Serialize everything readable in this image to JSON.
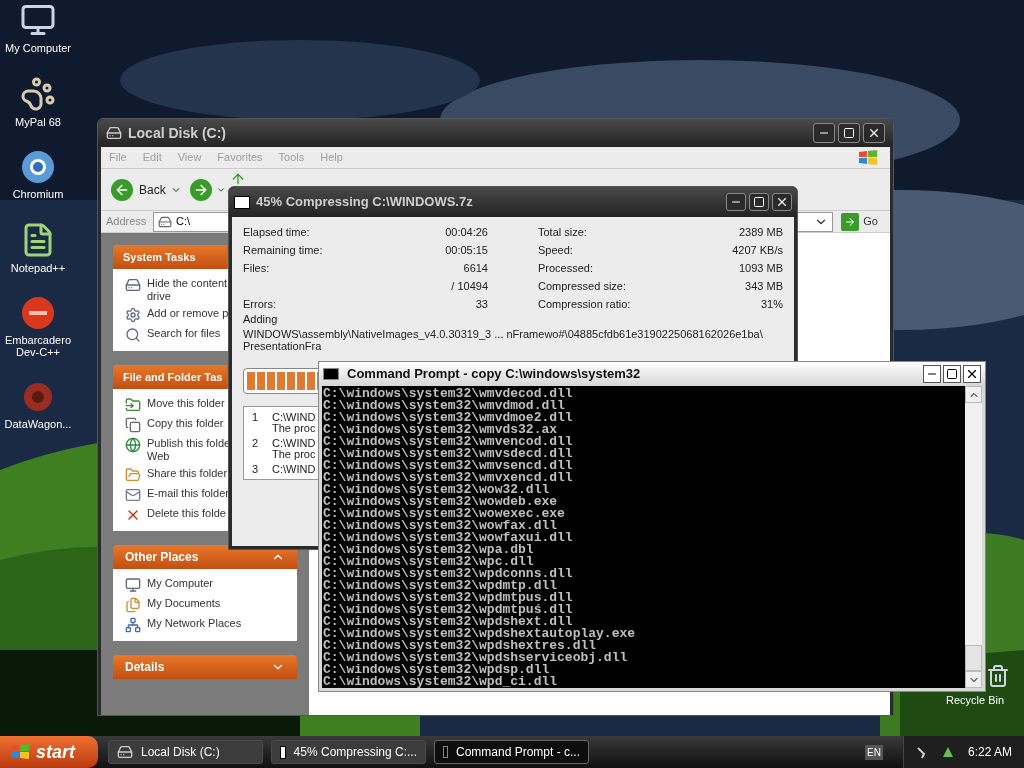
{
  "desktop_icons": [
    {
      "label": "My Computer",
      "kind": "computer"
    },
    {
      "label": "MyPal 68",
      "kind": "browser-paw"
    },
    {
      "label": "Chromium",
      "kind": "browser-round"
    },
    {
      "label": "Notepad++",
      "kind": "editor"
    },
    {
      "label": "Embarcadero Dev-C++",
      "kind": "ide"
    },
    {
      "label": "DataWagon...",
      "kind": "app"
    }
  ],
  "recycle_bin": {
    "label": "Recycle Bin"
  },
  "explorer": {
    "title": "Local Disk (C:)",
    "menu": [
      "File",
      "Edit",
      "View",
      "Favorites",
      "Tools",
      "Help"
    ],
    "back": "Back",
    "address_label": "Address",
    "address_value": "C:\\",
    "go": "Go",
    "panels": [
      {
        "title": "System Tasks",
        "kind": "plain",
        "expanded": true,
        "items": [
          {
            "kind": "drive",
            "lines": [
              "Hide the content",
              "drive"
            ]
          },
          {
            "kind": "gear",
            "lines": [
              "Add or remove p"
            ]
          },
          {
            "kind": "search",
            "lines": [
              "Search for files"
            ]
          }
        ]
      },
      {
        "title": "File and Folder Tas",
        "kind": "plain",
        "expanded": true,
        "items": [
          {
            "kind": "move",
            "lines": [
              "Move this folder"
            ]
          },
          {
            "kind": "copy",
            "lines": [
              "Copy this folder"
            ]
          },
          {
            "kind": "globe",
            "lines": [
              "Publish this folde",
              "Web"
            ]
          },
          {
            "kind": "share",
            "lines": [
              "Share this folder"
            ]
          },
          {
            "kind": "mail",
            "lines": [
              "E-mail this folder"
            ]
          },
          {
            "kind": "delete",
            "lines": [
              "Delete this folde"
            ]
          }
        ]
      },
      {
        "title": "Other Places",
        "kind": "toggle",
        "expanded": true,
        "items": [
          {
            "kind": "computer",
            "lines": [
              "My Computer"
            ]
          },
          {
            "kind": "docs",
            "lines": [
              "My Documents"
            ]
          },
          {
            "kind": "network",
            "lines": [
              "My Network Places"
            ]
          }
        ]
      },
      {
        "title": "Details",
        "kind": "toggle",
        "expanded": false
      }
    ]
  },
  "sevenzip": {
    "title": "45% Compressing C:\\WINDOWS.7z",
    "left_stats": [
      {
        "label": "Elapsed time:",
        "value": "00:04:26"
      },
      {
        "label": "Remaining time:",
        "value": "00:05:15"
      },
      {
        "label": "Files:",
        "value": "6614"
      },
      {
        "value": "/ 10494"
      },
      {
        "label": "Errors:",
        "value": "33"
      }
    ],
    "right_stats": [
      {
        "label": "Total size:",
        "value": "2389 MB"
      },
      {
        "label": "Speed:",
        "value": "4207 KB/s"
      },
      {
        "label": "Processed:",
        "value": "1093 MB"
      },
      {
        "label": "Compressed size:",
        "value": "343 MB"
      },
      {
        "label": "Compression ratio:",
        "value": "31%"
      }
    ],
    "action": "Adding",
    "path_lines": [
      "WINDOWS\\assembly\\NativeImages_v4.0.30319_3 ... nFramewo#\\04885cfdb61e3190225068162026e1ba\\",
      "PresentationFra"
    ],
    "progress": {
      "level": 0.45
    },
    "errors": [
      {
        "num": "1",
        "path": "C:\\WIND",
        "message": "The proc"
      },
      {
        "num": "2",
        "path": "C:\\WIND",
        "message": "The proc"
      },
      {
        "num": "3",
        "path": "C:\\WIND"
      }
    ]
  },
  "console": {
    "title": "Command Prompt - copy C:\\windows\\system32",
    "lines": [
      "C:\\windows\\system32\\wmvdecod.dll",
      "C:\\windows\\system32\\wmvdmod.dll",
      "C:\\windows\\system32\\wmvdmoe2.dll",
      "C:\\windows\\system32\\wmvds32.ax",
      "C:\\windows\\system32\\wmvencod.dll",
      "C:\\windows\\system32\\wmvsdecd.dll",
      "C:\\windows\\system32\\wmvsencd.dll",
      "C:\\windows\\system32\\wmvxencd.dll",
      "C:\\windows\\system32\\wow32.dll",
      "C:\\windows\\system32\\wowdeb.exe",
      "C:\\windows\\system32\\wowexec.exe",
      "C:\\windows\\system32\\wowfax.dll",
      "C:\\windows\\system32\\wowfaxui.dll",
      "C:\\windows\\system32\\wpa.dbl",
      "C:\\windows\\system32\\wpc.dll",
      "C:\\windows\\system32\\wpdconns.dll",
      "C:\\windows\\system32\\wpdmtp.dll",
      "C:\\windows\\system32\\wpdmtpus.dll",
      "C:\\windows\\system32\\wpdmtpuś.dll",
      "C:\\windows\\system32\\wpdshext.dll",
      "C:\\windows\\system32\\wpdshextautoplay.exe",
      "C:\\windows\\system32\\wpdshextres.dll",
      "C:\\windows\\system32\\wpdshserviceobj.dll",
      "C:\\windows\\system32\\wpdsp.dll",
      "C:\\windows\\system32\\wpd_ci.dll"
    ]
  },
  "taskbar": {
    "start": "start",
    "tasks": [
      {
        "label": "Local Disk (C:)",
        "kind": "drive",
        "selected": false
      },
      {
        "label": "45% Compressing C:...",
        "kind": "sevenzip",
        "selected": false
      },
      {
        "label": "Command Prompt - c...",
        "kind": "console",
        "selected": true
      }
    ],
    "language": "EN",
    "time": "6:22 AM"
  }
}
